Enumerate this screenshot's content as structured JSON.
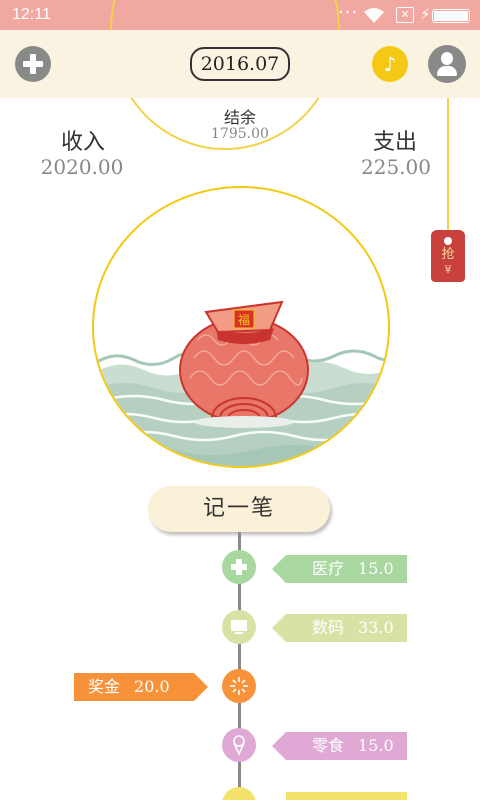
{
  "status_bar": {
    "time": "12:11",
    "battery_level": 1.0,
    "icons": [
      "more-dots-icon",
      "wifi-icon",
      "no-sim-icon",
      "charging-bolt-icon",
      "battery-icon"
    ]
  },
  "header": {
    "date": "2016.07",
    "add_icon": "plus-icon",
    "music_icon": "music-note-icon",
    "user_icon": "user-icon"
  },
  "summary": {
    "balance_label": "结余",
    "balance_value": "1795.00",
    "income_label": "收入",
    "income_value": "2020.00",
    "expense_label": "支出",
    "expense_value": "225.00"
  },
  "red_packet": {
    "text": "抢",
    "symbol": "¥"
  },
  "pouch": {
    "character": "福"
  },
  "record_button": {
    "label": "记一笔"
  },
  "timeline": {
    "entries": [
      {
        "side": "right",
        "category": "医疗",
        "amount": "15.0",
        "icon": "medical-cross-icon",
        "color": "#a8d8a0"
      },
      {
        "side": "right",
        "category": "数码",
        "amount": "33.0",
        "icon": "monitor-icon",
        "color": "#d8e2a4"
      },
      {
        "side": "left",
        "category": "奖金",
        "amount": "20.0",
        "icon": "sparkle-icon",
        "color": "#f7923a"
      },
      {
        "side": "right",
        "category": "零食",
        "amount": "15.0",
        "icon": "ice-cream-icon",
        "color": "#e0a8d4"
      }
    ]
  },
  "colors": {
    "status_bar": "#f0a8a0",
    "header_bg": "#fbf3e1",
    "accent_yellow": "#f3c916",
    "icon_gray": "#888a87",
    "pouch_red": "#e8776a",
    "wave_green": "#a6c7b6"
  }
}
